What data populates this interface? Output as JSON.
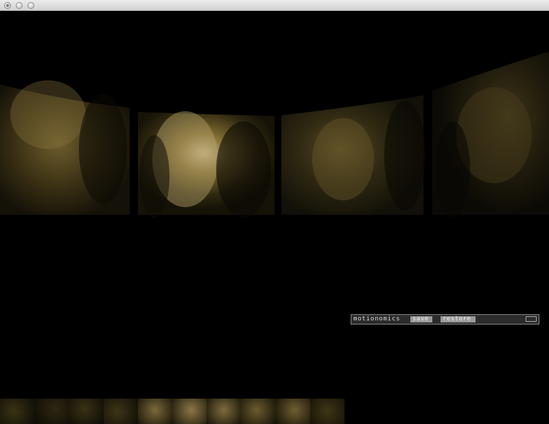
{
  "window": {
    "controls": [
      "close",
      "minimize",
      "zoom"
    ]
  },
  "hud": {
    "title": "motionomics",
    "save_label": "save",
    "restore_label": "restore"
  },
  "colors": {
    "background": "#000000",
    "hud_bg": "#2c2c2c",
    "hud_button": "#9a9a9a",
    "image_tint": "#6b5a20"
  },
  "panels": [
    "face-panel-1",
    "face-panel-2",
    "face-panel-3",
    "face-panel-4"
  ],
  "filmstrip": {
    "thumbnail_count": 10
  }
}
